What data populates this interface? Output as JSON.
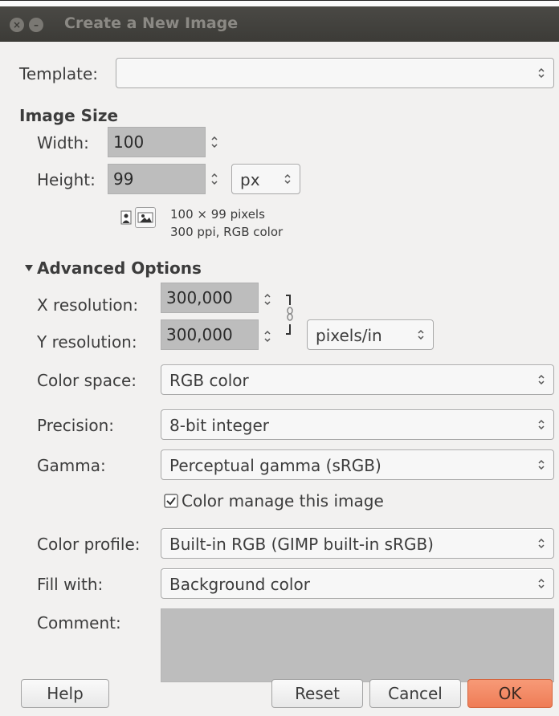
{
  "window": {
    "title": "Create a New Image"
  },
  "template": {
    "label": "Template:",
    "value": ""
  },
  "image_size": {
    "heading": "Image Size",
    "width_label": "Width:",
    "width_value": "100",
    "height_label": "Height:",
    "height_value": "99",
    "unit": "px",
    "info_line1": "100 × 99 pixels",
    "info_line2": "300 ppi, RGB color"
  },
  "advanced": {
    "heading": "Advanced Options",
    "xres_label": "X resolution:",
    "xres_value": "300,000",
    "yres_label": "Y resolution:",
    "yres_value": "300,000",
    "res_unit": "pixels/in",
    "colorspace_label": "Color space:",
    "colorspace_value": "RGB color",
    "precision_label": "Precision:",
    "precision_value": "8-bit integer",
    "gamma_label": "Gamma:",
    "gamma_value": "Perceptual gamma (sRGB)",
    "colormanage_label": "Color manage this image",
    "colormanage_checked": true,
    "profile_label": "Color profile:",
    "profile_value": "Built-in RGB (GIMP built-in sRGB)",
    "fill_label": "Fill with:",
    "fill_value": "Background color",
    "comment_label": "Comment:",
    "comment_value": ""
  },
  "buttons": {
    "help": "Help",
    "reset": "Reset",
    "cancel": "Cancel",
    "ok": "OK"
  },
  "colors": {
    "ok_accent": "#ef7c56",
    "titlebar": "#3c3b37",
    "field_bg": "#bdbdbd"
  }
}
